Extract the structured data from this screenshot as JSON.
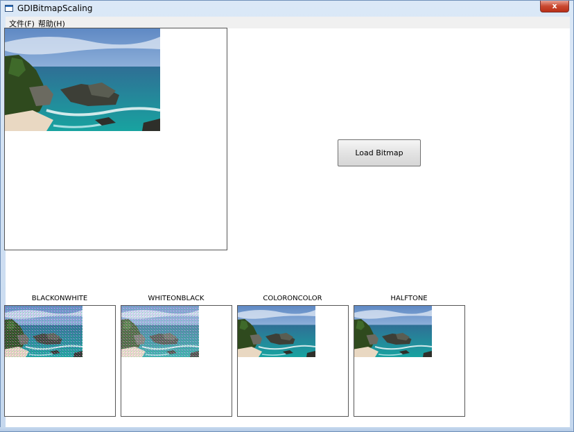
{
  "window": {
    "title": "GDIBitmapScaling",
    "close_glyph": "x"
  },
  "menu": {
    "file": "文件(F)",
    "help": "帮助(H)"
  },
  "button": {
    "load_label": "Load Bitmap"
  },
  "modes": [
    {
      "label": "BLACKONWHITE"
    },
    {
      "label": "WHITEONBLACK"
    },
    {
      "label": "COLORONCOLOR"
    },
    {
      "label": "HALFTONE"
    }
  ],
  "icons": {
    "app": "window-icon",
    "close": "close-icon"
  }
}
